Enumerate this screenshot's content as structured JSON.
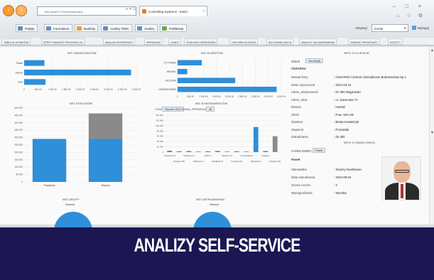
{
  "browser": {
    "address": "http://test07:1334/default.aspx",
    "address_tools": "⌕ ▾ ↻",
    "tab_title": "Controlling Systems - Ewid...",
    "tab_close": "×",
    "window_controls": "– □ ×",
    "toolbar_icons": "⌂ ☆ ⚙"
  },
  "favorites": [
    {
      "label": "Pulpity"
    },
    {
      "label": "Formularze"
    },
    {
      "label": "Budżety"
    },
    {
      "label": "Analizy OWC"
    },
    {
      "label": "Analizy"
    },
    {
      "label": "Publikacje"
    }
  ],
  "user": {
    "label": "Aktywny:",
    "value": "Zosfia",
    "logout": "Wyloguj"
  },
  "main_tabs": [
    "TABLICA WYNIKÓW",
    "EFEKTYWNOŚĆ PROCESU HH",
    "ANALIZA SPRZEDAŻY",
    "SPRZEDAŻ",
    "LEADY",
    "STAN MOJ REGIONÓW",
    "HISTORIA KLIENTA",
    "WG HANDLOWCA",
    "ANALIZY NA ZAMÓWIENIE",
    "SZANSE SPRZEDAŻY",
    "KOSZTY"
  ],
  "panels": {
    "handlowcy_title": "WG HANDLOWCÓW",
    "klienci_title": "WG KLIENTÓW",
    "statusy_title": "WG STATUSÓW",
    "kontrahenci_title": "WG KONTRAHENTÓW",
    "grupy_title": "WG GRUPY",
    "zatrudnienie_title": "WG ZATRUDNIENIA",
    "grupy_sub": "Absolut",
    "zatrudnienie_sub": "Warsza",
    "filter_label": "CZAS",
    "filter_value": "Styczeń 2013",
    "filter2_label": "SUMA_SPRZEDAŻY",
    "filter2_value": "48"
  },
  "chart_data": [
    {
      "type": "bar",
      "title": "WG HANDLOWCÓW",
      "orientation": "horizontal",
      "categories": [
        "Pawel",
        "Joanna",
        "Ewa"
      ],
      "values": [
        760,
        4000,
        800
      ],
      "xticks": [
        "0",
        "500 00",
        "1 000 00",
        "1 500 00",
        "2 000 00",
        "2 500 00",
        "3 000 00",
        "3 500 00",
        "4 000 00"
      ],
      "xlim": [
        0,
        4200
      ]
    },
    {
      "type": "bar",
      "title": "WG KLIENTÓW",
      "orientation": "horizontal",
      "categories": [
        "CYTYWSKI",
        "HENKEL",
        "SZCZUNA",
        "LEWANDOWSKI"
      ],
      "values": [
        1050,
        420,
        2500,
        4300
      ],
      "xticks": [
        "0",
        "500 00",
        "1 000 00",
        "1 500 00",
        "2 000 00",
        "2 500 00",
        "3 000 00",
        "3 500 00",
        "4 000 00"
      ],
      "xlim": [
        0,
        4500
      ]
    },
    {
      "type": "bar",
      "title": "WG STATUSÓW",
      "stacked": true,
      "categories": [
        "Pozyskany",
        "Aktywny"
      ],
      "series": [
        {
          "values": [
            320,
            320
          ],
          "color": "#2f8fd8"
        },
        {
          "values": [
            0,
            190
          ],
          "color": "#8a8a8a"
        }
      ],
      "yticks": [
        "0",
        "50 000",
        "100 000",
        "150 000",
        "200 000",
        "250 000",
        "300 000",
        "350 000",
        "400 000",
        "450 000",
        "500 000"
      ],
      "ylim": [
        0,
        550
      ]
    },
    {
      "type": "bar",
      "title": "WG KONTRAHENTÓW",
      "categories": [
        "Prosperus 1997",
        "Prosperus B2",
        "Prosperus dla sprzedaży",
        "Polibrexon dla budownictwa",
        "Hotel 2 x",
        "Handlowiec Rozwój",
        "Eksporter x4 Budowa dla przemysłu",
        "Prosperus 2005",
        "Lucymandowski",
        "Rejestrant Systemy",
        "Sergatos",
        "Prosperus Rozliczeniowy"
      ],
      "values": [
        5,
        3,
        4,
        2,
        3,
        4,
        2,
        3,
        2,
        95,
        4,
        60
      ],
      "yticks": [
        "0",
        "20 000",
        "40 000",
        "60 000",
        "80 000",
        "100 000",
        "120 000",
        "140 000"
      ],
      "ylim": [
        0,
        140
      ]
    }
  ],
  "info": {
    "title": "INFO O KLIENCIE",
    "widok_label": "Widok",
    "widok_value": "Szczegóły",
    "section": "CEZAROZ",
    "fields": [
      {
        "label": "Nazwa firmy",
        "value": ": CEZAROZ Centrum Zarządzania Budownictwa Sp.1"
      },
      {
        "label": "Data rozpoczęcia",
        "value": ": 2012-03-31"
      },
      {
        "label": "Adres_miejscowość",
        "value": ": 87-300 Wągrowiec"
      },
      {
        "label": "Adres_ulica",
        "value": ": ul. Jaworowa 7A"
      },
      {
        "label": "Branża",
        "value": ": Handel"
      },
      {
        "label": "Obrót",
        "value": ": Pow. 100 mln"
      },
      {
        "label": "Opiekun",
        "value": ": Beata Kowalczyk"
      },
      {
        "label": "Segment",
        "value": ": Pozostałe"
      },
      {
        "label": "Zatrudnianie",
        "value": ": do 300"
      }
    ],
    "handlowiec_title": "INFO O HANDLOWCU",
    "handlowiec_label": "HANDLOWIEC",
    "handlowiec_btn": "Paweł",
    "handlowiec_name": "Paweł",
    "handlowiec_fields": [
      {
        "label": "Stanowisko",
        "value": ": Starszy handlowiec"
      },
      {
        "label": "Data zatrudnienia",
        "value": ": 2010-09-01"
      },
      {
        "label": "Ocena roczna",
        "value": ": 3"
      },
      {
        "label": "Wynagrodzenie",
        "value": ": Wysoka"
      }
    ]
  },
  "scroll": {
    "up": "▲",
    "down": "▼"
  },
  "banner": {
    "text": "ANALIZY SELF-SERVICE"
  }
}
